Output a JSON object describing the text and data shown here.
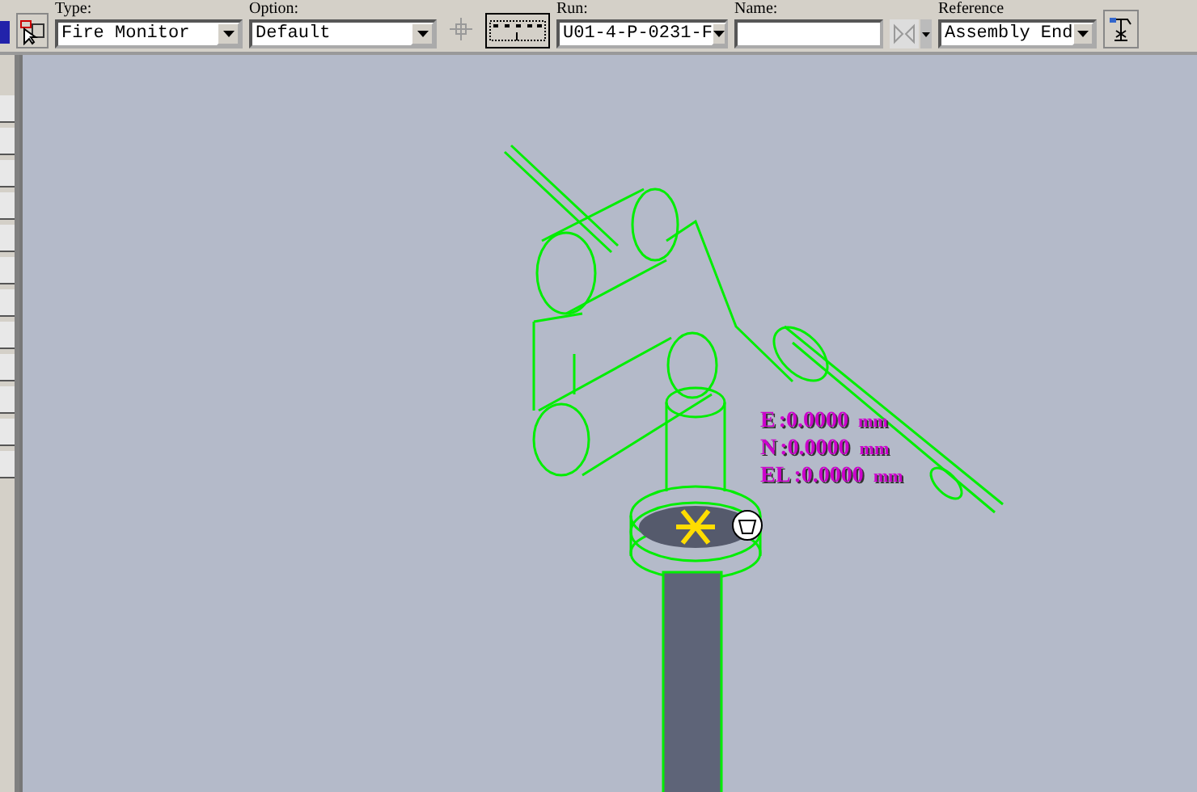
{
  "toolbar": {
    "fields": [
      {
        "kind": "dropdown",
        "label": "Type:",
        "value": "Fire Monitor"
      },
      {
        "kind": "dropdown",
        "label": "Option:",
        "value": "Default"
      },
      {
        "kind": "dropdown",
        "label": "Run:",
        "value": "U01-4-P-0231-F"
      },
      {
        "kind": "text",
        "label": "Name:"
      },
      {
        "kind": "dropdown",
        "label": "Reference",
        "value": "Assembly End"
      }
    ]
  },
  "coordinates": [
    {
      "axis": "E",
      "value": ":0.0000",
      "unit": "mm"
    },
    {
      "axis": "N",
      "value": ":0.0000",
      "unit": "mm"
    },
    {
      "axis": "EL",
      "value": ":0.0000",
      "unit": "mm"
    }
  ]
}
